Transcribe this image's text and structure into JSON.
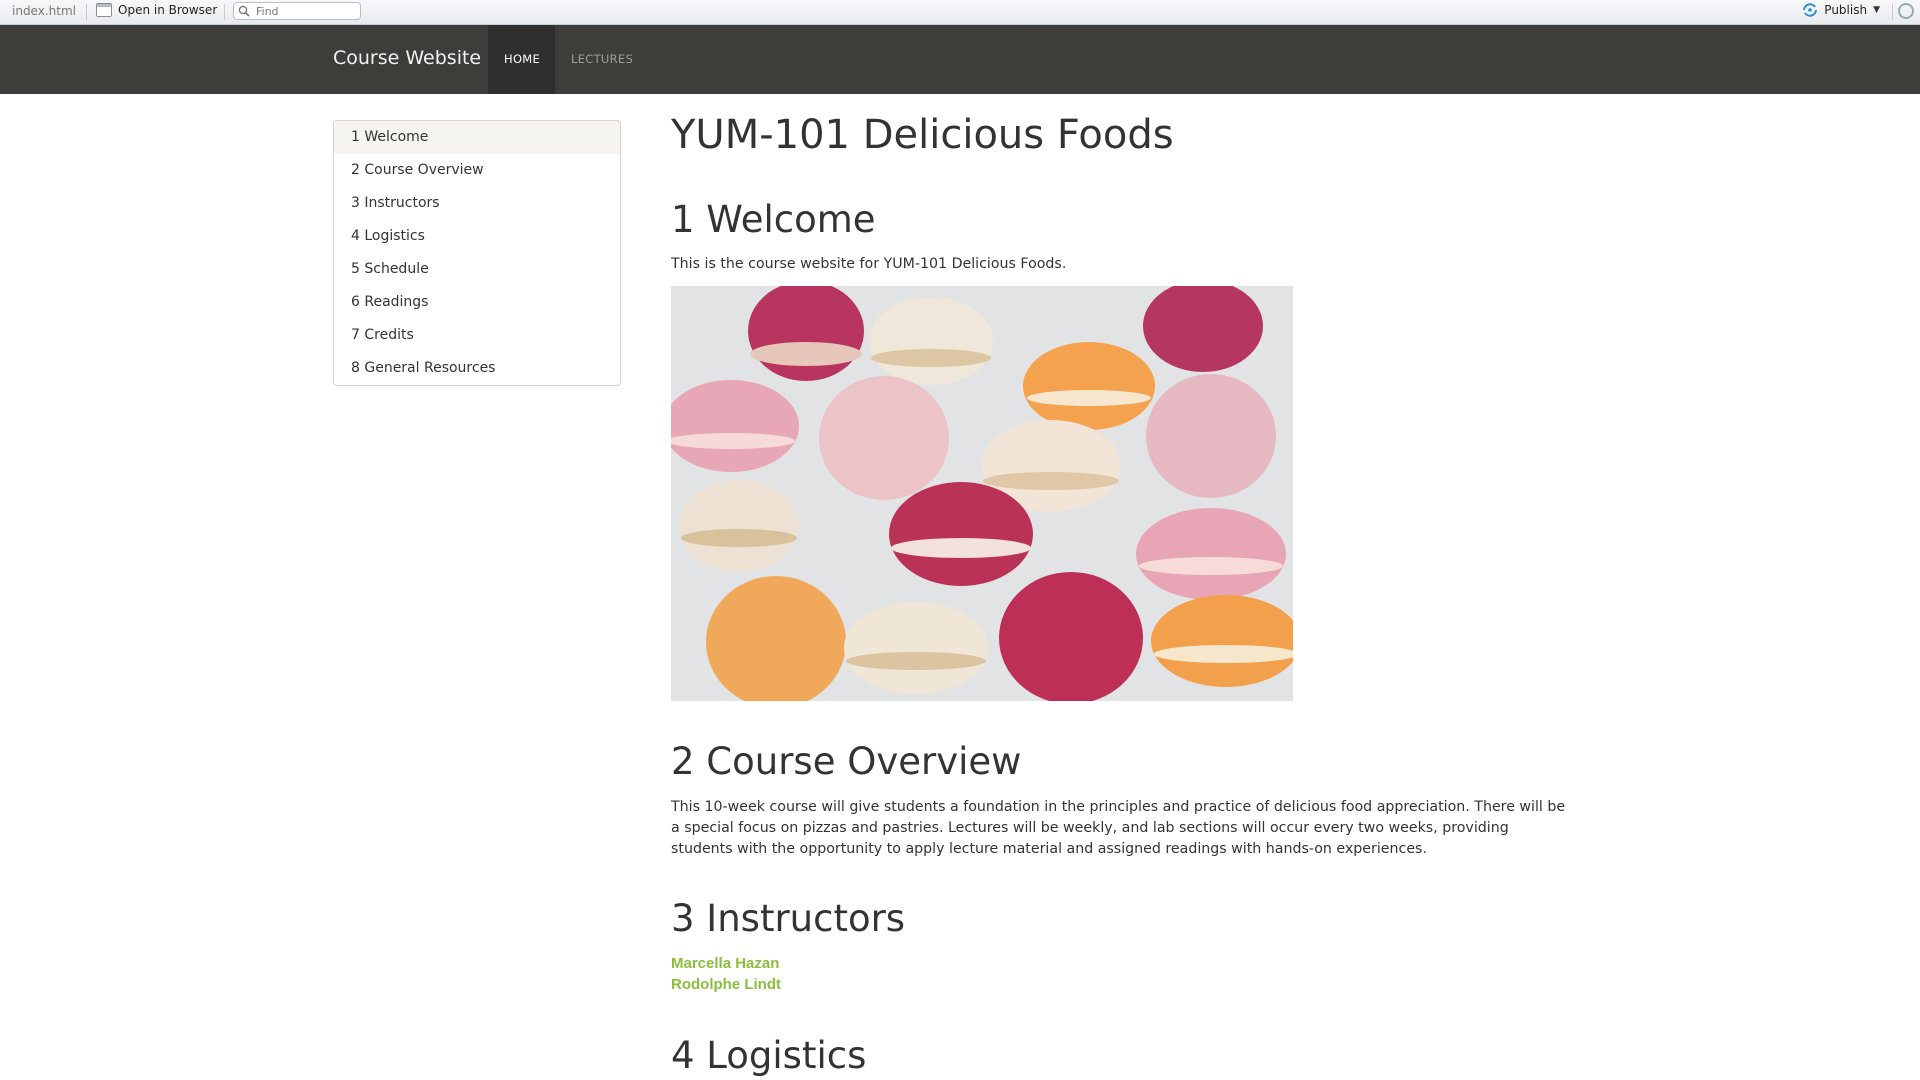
{
  "toolbar": {
    "file_name": "index.html",
    "open_in_browser": "Open in Browser",
    "find_placeholder": "Find",
    "publish": "Publish"
  },
  "navbar": {
    "brand": "Course Website",
    "items": [
      {
        "label": "HOME",
        "active": true
      },
      {
        "label": "LECTURES",
        "active": false
      }
    ]
  },
  "toc": {
    "items": [
      {
        "label": "1 Welcome",
        "active": true
      },
      {
        "label": "2 Course Overview"
      },
      {
        "label": "3 Instructors"
      },
      {
        "label": "4 Logistics"
      },
      {
        "label": "5 Schedule"
      },
      {
        "label": "6 Readings"
      },
      {
        "label": "7 Credits"
      },
      {
        "label": "8 General Resources"
      }
    ]
  },
  "content": {
    "title": "YUM-101 Delicious Foods",
    "welcome": {
      "heading": "1 Welcome",
      "text": "This is the course website for YUM-101 Delicious Foods."
    },
    "overview": {
      "heading": "2 Course Overview",
      "text": "This 10-week course will give students a foundation in the principles and practice of delicious food appreciation. There will be a special focus on pizzas and pastries. Lectures will be weekly, and lab sections will occur every two weeks, providing students with the opportunity to apply lecture material and assigned readings with hands-on experiences."
    },
    "instructors": {
      "heading": "3 Instructors",
      "people": [
        "Marcella Hazan",
        "Rodolphe Lindt"
      ]
    },
    "logistics": {
      "heading": "4 Logistics"
    }
  },
  "colors": {
    "navbar_bg": "#3d3d3a",
    "link_green": "#8bbd3f",
    "toc_active_bg": "#f6f4ef"
  }
}
